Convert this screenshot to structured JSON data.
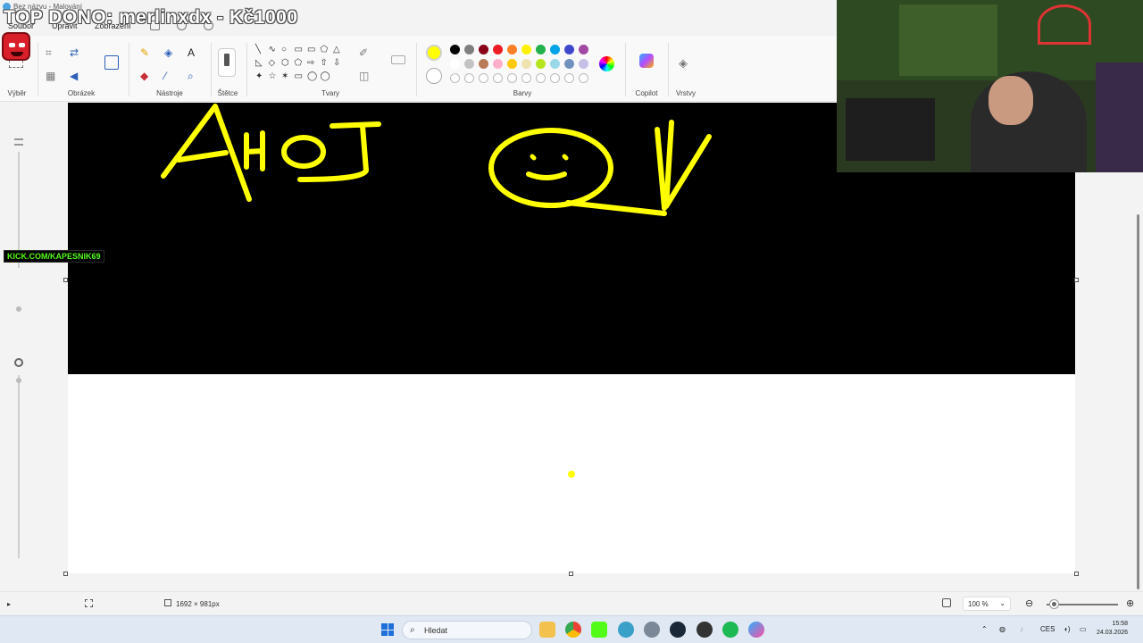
{
  "window": {
    "title": "Bez názvu - Malování"
  },
  "overlay": {
    "donation": "TOP DONO: merlinxdx - Kč1000",
    "kick": "KICK.COM/KAPESNIK69"
  },
  "menu": {
    "file": "Soubor",
    "edit": "Upravit",
    "view": "Zobrazení"
  },
  "ribbon": {
    "groups": {
      "selection": "Výběr",
      "image": "Obrázek",
      "tools": "Nástroje",
      "brushes": "Štětce",
      "shapes": "Tvary",
      "colors": "Barvy",
      "copilot": "Copilot",
      "layers": "Vrstvy"
    },
    "tool_glyphs": {
      "text": "A",
      "zoom": "⌕",
      "pencil": "✎"
    },
    "shapes": [
      "╲",
      "∿",
      "○",
      "▭",
      "▭",
      "⬠",
      "△",
      "◺",
      "◇",
      "⬡",
      "⬠",
      "⇨",
      "⇧",
      "⇩",
      "✦",
      "☆",
      "✶",
      "▭",
      "◯",
      "◯"
    ],
    "active_color": "#ffff00",
    "palette_row1": [
      "#000000",
      "#7f7f7f",
      "#880015",
      "#ed1c24",
      "#ff7f27",
      "#fff200",
      "#22b14c",
      "#00a2e8",
      "#3f48cc",
      "#a349a4"
    ],
    "palette_row2": [
      "#ffffff",
      "#c3c3c3",
      "#b97a57",
      "#ffaec9",
      "#ffc90e",
      "#efe4b0",
      "#b5e61d",
      "#99d9ea",
      "#7092be",
      "#c8bfe7"
    ]
  },
  "status": {
    "canvas_size": "1692 × 981px",
    "zoom": "100 %"
  },
  "taskbar": {
    "search_placeholder": "Hledat",
    "language": "CES",
    "time": "15:58",
    "date": "24.03.2026"
  }
}
